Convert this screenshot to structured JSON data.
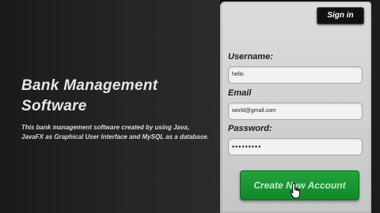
{
  "left_panel": {
    "title_line1": "Bank Management",
    "title_line2": "Software",
    "description": "This bank management software created by using Java, JavaFX as Graphical User Interface and MySQL as a database."
  },
  "header": {
    "signin_label": "Sign in"
  },
  "form": {
    "username_label": "Username:",
    "username_value": "hello",
    "email_label": "Email",
    "email_value": "world@gmail.com",
    "password_label": "Password:",
    "password_value": "•••••••••",
    "create_label": "Create New Account"
  },
  "icons": {
    "cursor": "hand-pointer-icon"
  }
}
